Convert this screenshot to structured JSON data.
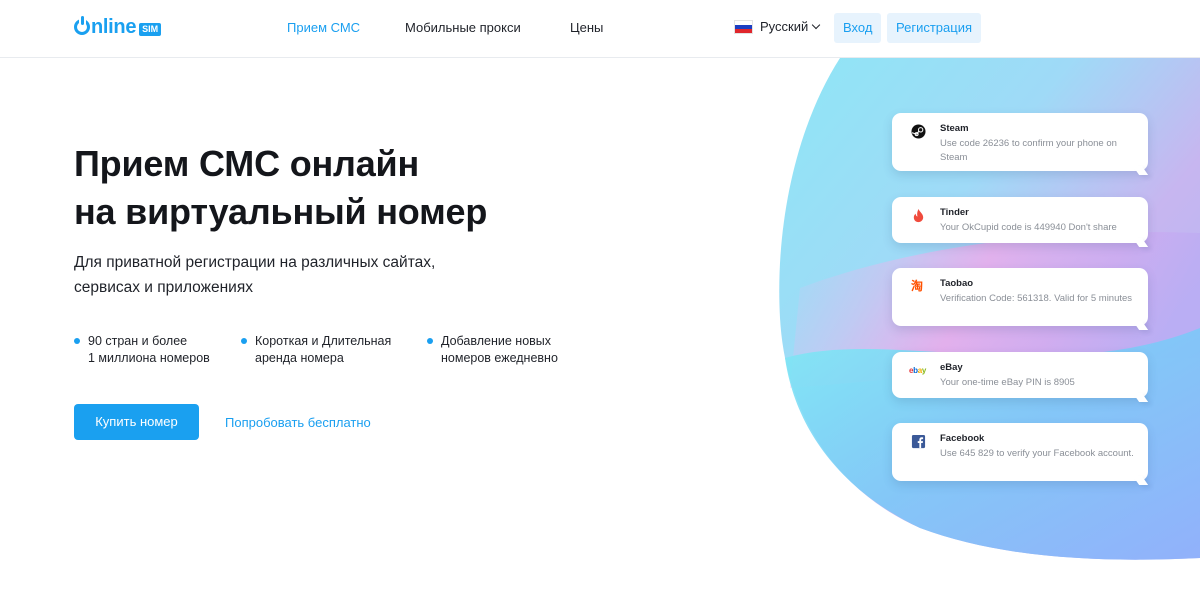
{
  "header": {
    "logo": {
      "text": "nline",
      "badge": "SIM"
    },
    "nav": [
      {
        "label": "Прием СМС",
        "active": true
      },
      {
        "label": "Мобильные прокси",
        "active": false
      },
      {
        "label": "Цены",
        "active": false
      }
    ],
    "language": "Русский",
    "login_label": "Вход",
    "register_label": "Регистрация"
  },
  "hero": {
    "title_line1": "Прием СМС онлайн",
    "title_line2": "на виртуальный номер",
    "subtitle": "Для приватной регистрации на различных сайтах, сервисах и приложениях",
    "features": [
      "90 стран и более\n1 миллиона номеров",
      "Короткая и Длительная\nаренда номера",
      "Добавление новых\nномеров ежедневно"
    ],
    "buy_label": "Купить номер",
    "try_label": "Попробовать бесплатно"
  },
  "messages": [
    {
      "app": "Steam",
      "icon": "steam-icon",
      "text": "Use code 26236 to confirm your phone on Steam"
    },
    {
      "app": "Tinder",
      "icon": "tinder-flame-icon",
      "text": "Your OkCupid code is 449940 Don't share"
    },
    {
      "app": "Taobao",
      "icon": "taobao-icon",
      "icon_text": "淘",
      "text": "Verification Code: 561318. Valid for 5 minutes"
    },
    {
      "app": "eBay",
      "icon": "ebay-icon",
      "icon_text": "ebay",
      "text": "Your one-time eBay PIN is 8905"
    },
    {
      "app": "Facebook",
      "icon": "facebook-icon",
      "icon_text": "f",
      "text": "Use 645 829 to verify your Facebook account."
    }
  ],
  "colors": {
    "accent": "#1aa0f0",
    "accent_light_bg": "#e7f3fd",
    "text_dark": "#14161b",
    "muted": "#8a8f97"
  }
}
